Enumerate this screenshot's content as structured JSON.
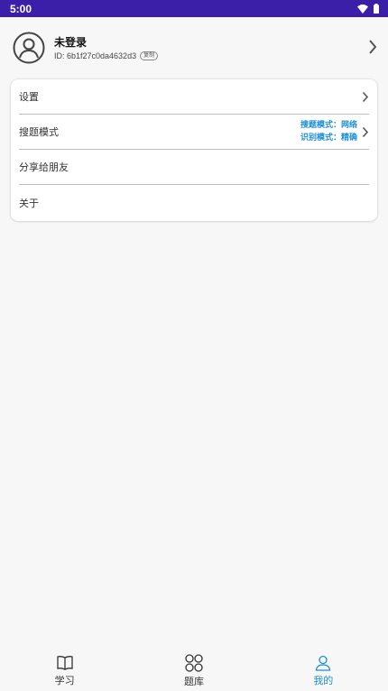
{
  "status_bar": {
    "time": "5:00",
    "bg_color": "#3b1fa8"
  },
  "profile": {
    "name": "未登录",
    "id_text": "ID: 6b1f27c0da4632d3",
    "copy_label": "复制",
    "avatar_icon": "user-circle-icon",
    "chevron_icon": "chevron-right-icon"
  },
  "menu": {
    "items": [
      {
        "label": "设置",
        "has_chevron": true
      },
      {
        "label": "搜题模式",
        "search_mode": "搜题模式：网络",
        "recognition_mode": "识别模式：精确",
        "has_chevron": true
      },
      {
        "label": "分享给朋友",
        "has_chevron": false
      },
      {
        "label": "关于",
        "has_chevron": false
      }
    ]
  },
  "accent_color": "#1e8fd6",
  "tabs": [
    {
      "label": "学习",
      "icon": "book-icon",
      "active": false
    },
    {
      "label": "题库",
      "icon": "grid-circles-icon",
      "active": false
    },
    {
      "label": "我的",
      "icon": "person-icon",
      "active": true
    }
  ]
}
